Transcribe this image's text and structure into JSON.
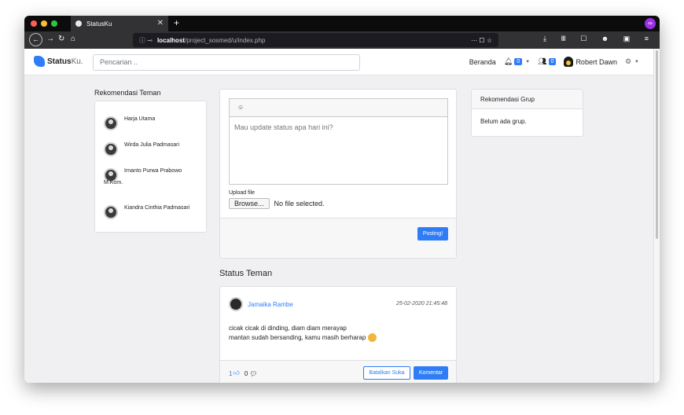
{
  "browser": {
    "tab_title": "StatusKu",
    "tab_close": "✕",
    "new_tab": "+",
    "url_host": "localhost",
    "url_path": "/project_sosmed/u/index.php",
    "url_icons": "··· ☐ ☆",
    "toolbar_icons": "⤓ Ⅲ ☐ ☻ ▣ ≡",
    "colors": {
      "close": "#fe5f57",
      "minimize": "#febc2e",
      "maximize": "#28c840"
    }
  },
  "site": {
    "brand_bold": "Status",
    "brand_light": "Ku.",
    "search_placeholder": "Pencarian ..",
    "nav": {
      "home": "Beranda",
      "notif_count": "0",
      "friend_req_count": "0",
      "user_name": "Robert Dawn"
    }
  },
  "friends": {
    "title": "Rekomendasi Teman",
    "items": [
      {
        "name": "Harja Utama"
      },
      {
        "name": "Wirda Julia Padmasari"
      },
      {
        "name": "Irnanto Purwa Prabowo"
      },
      {
        "name": "M.Kom."
      },
      {
        "name": "Kiandra Cinthia Padmasari"
      }
    ]
  },
  "composer": {
    "placeholder": "Mau update status apa hari ini?",
    "upload_label": "Upload file",
    "browse_label": "Browse...",
    "file_status": "No file selected.",
    "post_button": "Posting!"
  },
  "feed": {
    "title": "Status Teman",
    "posts": [
      {
        "author": "Jamaika Rambe",
        "date": "25-02-2020 21:45:48",
        "line1": "cicak cicak di dinding, diam diam merayap",
        "line2": "mantan sudah bersanding, kamu masih berharap",
        "like_count": "1",
        "comment_count": "0",
        "unlike_button": "Batalkan Suka",
        "comment_button": "Komentar"
      }
    ]
  },
  "groups": {
    "title": "Rekomendasi Grup",
    "empty": "Belum ada grup."
  }
}
